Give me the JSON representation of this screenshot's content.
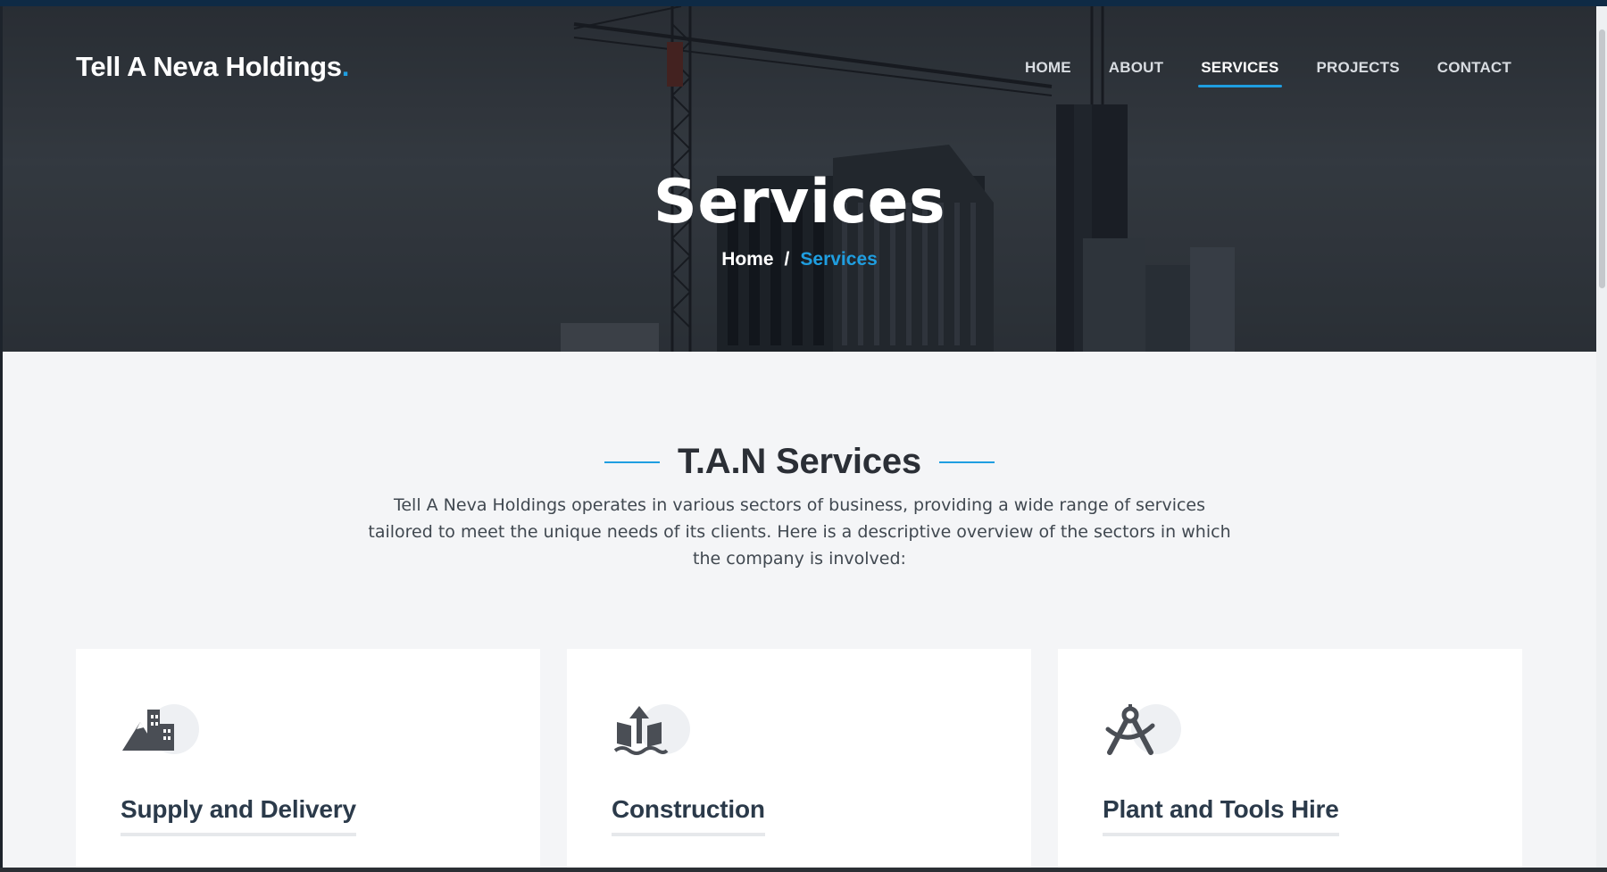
{
  "site": {
    "logo_text": "Tell A Neva Holdings",
    "logo_dot": "."
  },
  "nav": {
    "items": [
      {
        "label": "HOME"
      },
      {
        "label": "ABOUT"
      },
      {
        "label": "SERVICES",
        "active": true
      },
      {
        "label": "PROJECTS"
      },
      {
        "label": "CONTACT"
      }
    ]
  },
  "hero": {
    "title": "Services",
    "breadcrumb": {
      "home": "Home",
      "separator": "/",
      "current": "Services"
    }
  },
  "section": {
    "title": "T.A.N Services",
    "description": "Tell A Neva Holdings operates in various sectors of business, providing a wide range of services tailored to meet the unique needs of its clients. Here is a descriptive overview of the sectors in which the company is involved:"
  },
  "cards": [
    {
      "title": "Supply and Delivery",
      "icon": "mountain-city-icon"
    },
    {
      "title": "Construction",
      "icon": "water-upload-icon"
    },
    {
      "title": "Plant and Tools Hire",
      "icon": "compass-drafting-icon"
    }
  ],
  "colors": {
    "accent": "#1f9ee0",
    "heading": "#2b2f36",
    "card_title": "#2b3a4a",
    "background": "#f4f5f7"
  }
}
